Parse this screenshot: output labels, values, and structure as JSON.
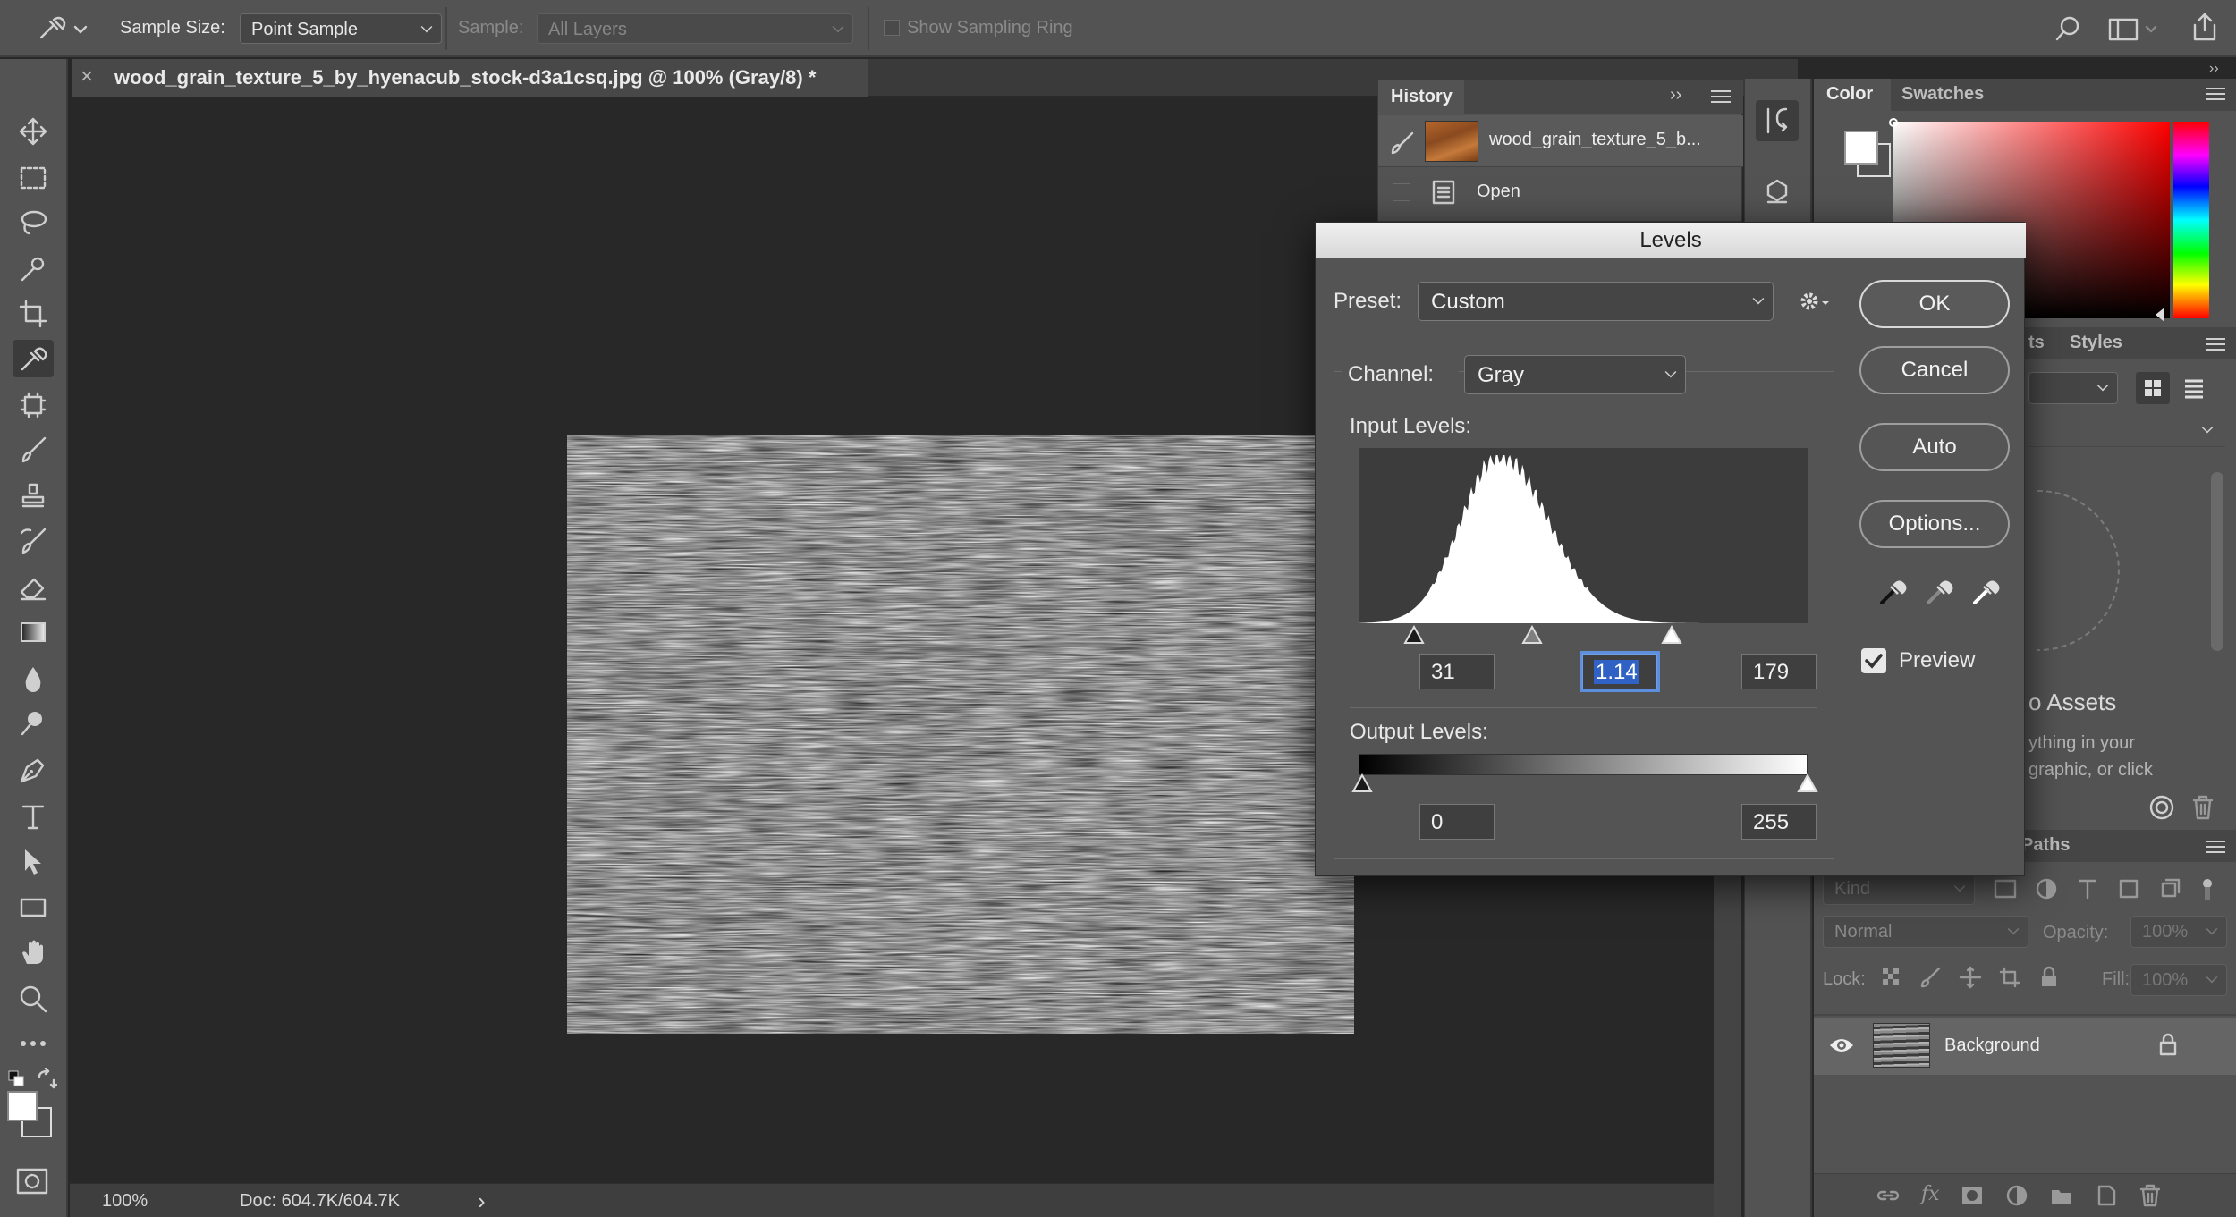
{
  "options_bar": {
    "sample_size_label": "Sample Size:",
    "sample_size_value": "Point Sample",
    "sample_label": "Sample:",
    "sample_value": "All Layers",
    "show_ring_label": "Show Sampling Ring"
  },
  "document": {
    "tab_title": "wood_grain_texture_5_by_hyenacub_stock-d3a1csq.jpg @ 100% (Gray/8) *",
    "close_glyph": "×"
  },
  "status": {
    "zoom": "100%",
    "doc_size": "Doc: 604.7K/604.7K",
    "arrow": "›"
  },
  "history": {
    "title": "History",
    "snapshot_name": "wood_grain_texture_5_b...",
    "steps": [
      "Open"
    ]
  },
  "color_panel": {
    "tab_color": "Color",
    "tab_swatches": "Swatches"
  },
  "libraries_panel": {
    "tab_partial": "ts",
    "tab_styles": "Styles",
    "assets_text": "o Assets",
    "hint_line1": "ything in your",
    "hint_line2": "graphic, or click"
  },
  "layers_panel": {
    "tab_paths": "Paths",
    "kind_placeholder": "Kind",
    "blend_mode": "Normal",
    "opacity_label": "Opacity:",
    "opacity_value": "100%",
    "lock_label": "Lock:",
    "fill_label": "Fill:",
    "fill_value": "100%",
    "layers": [
      {
        "name": "Background",
        "visible": true,
        "locked": true
      }
    ]
  },
  "levels_dialog": {
    "title": "Levels",
    "preset_label": "Preset:",
    "preset_value": "Custom",
    "channel_label": "Channel:",
    "channel_value": "Gray",
    "input_levels_label": "Input Levels:",
    "input_black": "31",
    "input_gamma": "1.14",
    "input_white": "179",
    "output_levels_label": "Output Levels:",
    "output_black": "0",
    "output_white": "255",
    "buttons": {
      "ok": "OK",
      "cancel": "Cancel",
      "auto": "Auto",
      "options": "Options..."
    },
    "preview_label": "Preview",
    "preview_checked": true,
    "histogram_peak_level": 80
  },
  "icons": {
    "tools": [
      "move-icon",
      "marquee-icon",
      "lasso-icon",
      "quick-select-icon",
      "crop-icon",
      "eyedropper-icon",
      "frame-icon",
      "brush-icon",
      "stamp-icon",
      "history-brush-icon",
      "eraser-icon",
      "gradient-icon",
      "blur-icon",
      "dodge-icon",
      "pen-icon",
      "type-icon",
      "path-select-icon",
      "rectangle-icon",
      "hand-icon",
      "zoom-icon",
      "more-icon"
    ]
  },
  "colors": {
    "ui_dark": "#535353",
    "canvas": "#282828",
    "accent_selection": "#2f62c4"
  }
}
